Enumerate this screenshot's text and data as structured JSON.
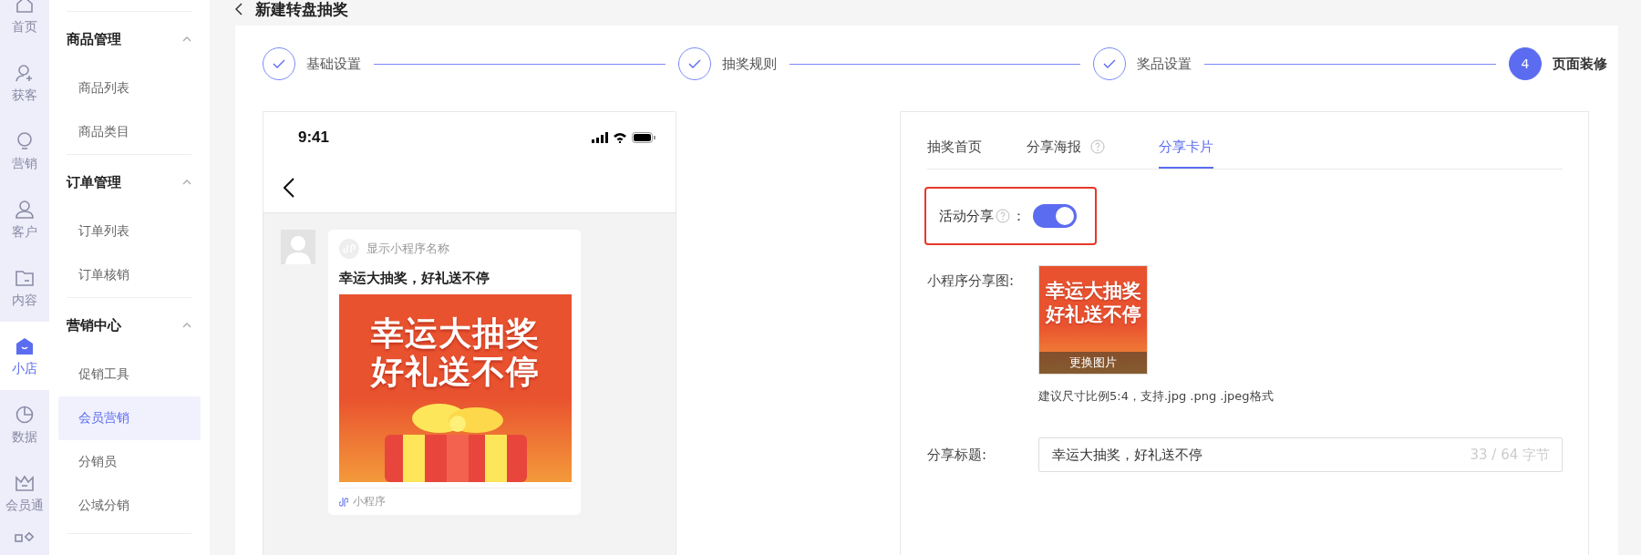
{
  "rail": [
    {
      "label": "首页",
      "selected": false
    },
    {
      "label": "获客",
      "selected": false
    },
    {
      "label": "营销",
      "selected": false
    },
    {
      "label": "客户",
      "selected": false
    },
    {
      "label": "内容",
      "selected": false
    },
    {
      "label": "小店",
      "selected": true
    },
    {
      "label": "数据",
      "selected": false
    },
    {
      "label": "会员通",
      "selected": false
    }
  ],
  "menu": [
    {
      "title": "商品管理",
      "expanded": true,
      "items": [
        {
          "label": "商品列表",
          "selected": false
        },
        {
          "label": "商品类目",
          "selected": false
        }
      ]
    },
    {
      "title": "订单管理",
      "expanded": true,
      "items": [
        {
          "label": "订单列表",
          "selected": false
        },
        {
          "label": "订单核销",
          "selected": false
        }
      ]
    },
    {
      "title": "营销中心",
      "expanded": true,
      "items": [
        {
          "label": "促销工具",
          "selected": false
        },
        {
          "label": "会员营销",
          "selected": true
        },
        {
          "label": "分销员",
          "selected": false
        },
        {
          "label": "公域分销",
          "selected": false
        }
      ]
    }
  ],
  "page_title": "新建转盘抽奖",
  "steps": [
    {
      "label": "基础设置",
      "done": true
    },
    {
      "label": "抽奖规则",
      "done": true
    },
    {
      "label": "奖品设置",
      "done": true
    },
    {
      "label": "页面装修",
      "done": false,
      "number": "4"
    }
  ],
  "preview": {
    "time": "9:41",
    "app_name": "显示小程序名称",
    "card_title": "幸运大抽奖，好礼送不停",
    "banner_lines": [
      "幸运大抽奖",
      "好礼送不停"
    ],
    "footer": "小程序"
  },
  "panel": {
    "tabs": [
      {
        "label": "抽奖首页",
        "selected": false,
        "help": false
      },
      {
        "label": "分享海报",
        "selected": false,
        "help": true
      },
      {
        "label": "分享卡片",
        "selected": true,
        "help": false
      }
    ],
    "share_toggle": {
      "label": "活动分享",
      "separator": "：",
      "on": true
    },
    "share_image": {
      "label": "小程序分享图:",
      "lines": [
        "幸运大抽奖",
        "好礼送不停"
      ],
      "button": "更换图片",
      "hint": "建议尺寸比例5:4，支持.jpg .png .jpeg格式"
    },
    "share_title": {
      "label": "分享标题:",
      "value": "幸运大抽奖，好礼送不停",
      "counter": "33 / 64 字节"
    }
  }
}
